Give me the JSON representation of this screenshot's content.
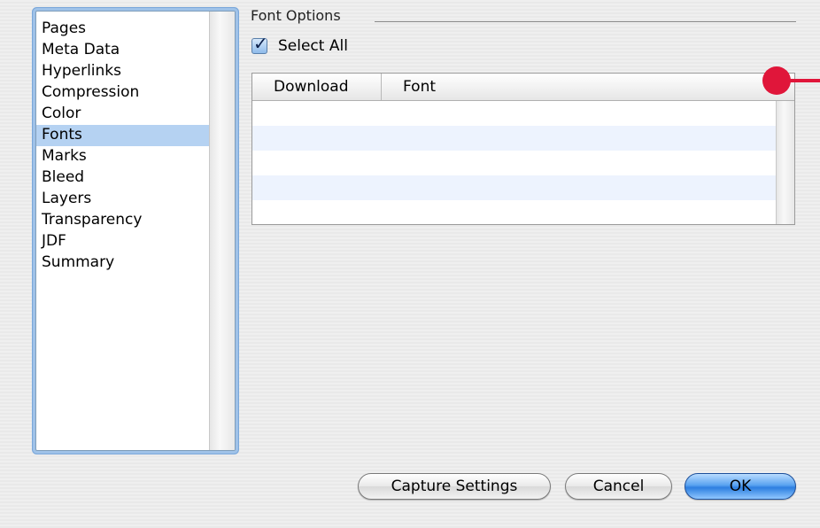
{
  "sidebar": {
    "items": [
      {
        "label": "Pages"
      },
      {
        "label": "Meta Data"
      },
      {
        "label": "Hyperlinks"
      },
      {
        "label": "Compression"
      },
      {
        "label": "Color"
      },
      {
        "label": "Fonts",
        "selected": true
      },
      {
        "label": "Marks"
      },
      {
        "label": "Bleed"
      },
      {
        "label": "Layers"
      },
      {
        "label": "Transparency"
      },
      {
        "label": "JDF"
      },
      {
        "label": "Summary"
      }
    ]
  },
  "font_options": {
    "title": "Font Options",
    "select_all": {
      "label": "Select All",
      "checked": true
    },
    "table": {
      "columns": [
        "Download",
        "Font"
      ],
      "rows": []
    }
  },
  "buttons": {
    "capture": "Capture Settings",
    "cancel": "Cancel",
    "ok": "OK"
  },
  "colors": {
    "selection": "#b5d2f2",
    "annotation": "#e0163a",
    "default_button": "#2d7fe0"
  }
}
